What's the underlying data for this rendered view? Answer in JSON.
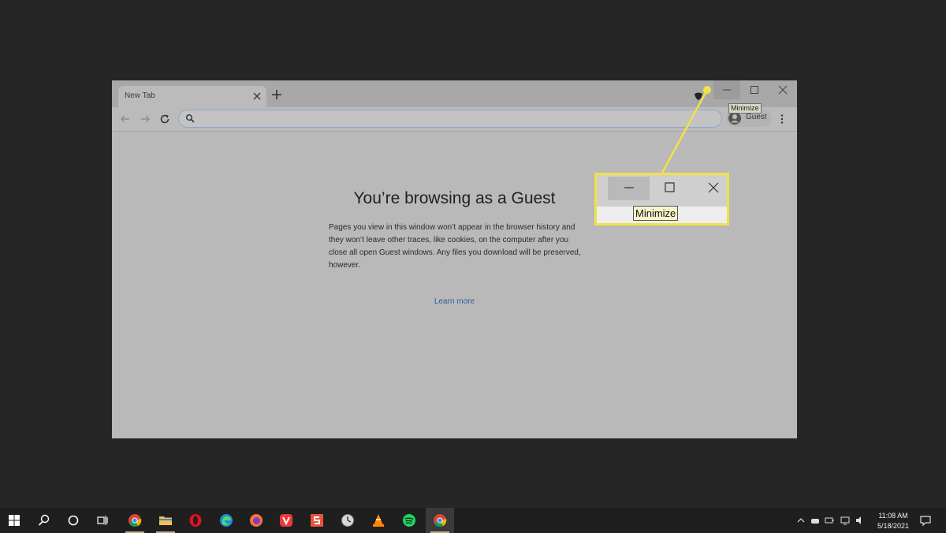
{
  "browser": {
    "tab": {
      "title": "New Tab"
    },
    "window_controls": {
      "minimize_tooltip": "Minimize"
    },
    "toolbar": {
      "omnibox": {
        "value": "",
        "placeholder": ""
      },
      "profile_label": "Guest"
    },
    "content": {
      "heading": "You’re browsing as a Guest",
      "body": "Pages you view in this window won’t appear in the browser history and they won’t leave other traces, like cookies, on the computer after you close all open Guest windows. Any files you download will be preserved, however.",
      "learn_more": "Learn more"
    }
  },
  "callout": {
    "tooltip": "Minimize",
    "highlight_color": "#f0e246"
  },
  "taskbar": {
    "apps": [
      "windows-start",
      "search",
      "cortana",
      "task-view",
      "chrome",
      "file-explorer",
      "opera",
      "edge",
      "firefox",
      "vivaldi",
      "sumo",
      "clock-app",
      "vlc",
      "spotify",
      "chrome-active"
    ],
    "clock": {
      "time": "11:08 AM",
      "date": "5/18/2021"
    }
  },
  "colors": {
    "desktop": "#262626",
    "browser_dim": "#b9b9ba",
    "link": "#2f5f9c",
    "taskbar": "#1f1f1f"
  }
}
